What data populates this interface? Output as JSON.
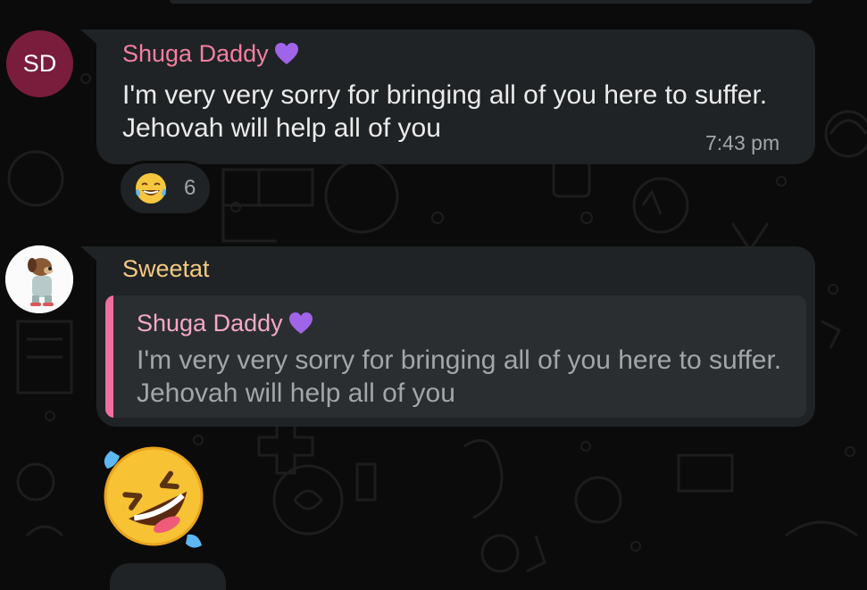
{
  "messages": [
    {
      "avatar_initials": "SD",
      "sender": "Shuga Daddy",
      "sender_badge": "purple-heart-icon",
      "text": "I'm very very sorry for bringing all of you here to suffer. Jehovah will help all of you",
      "time": "7:43 pm",
      "reaction": {
        "emoji": "face-with-tears-of-joy",
        "count": "6"
      }
    },
    {
      "sender": "Sweetat",
      "reply_to": {
        "sender": "Shuga Daddy",
        "sender_badge": "purple-heart-icon",
        "text": "I'm very very sorry for bringing all of you here to suffer. Jehovah will help all of you"
      },
      "content_emoji": "rolling-on-the-floor-laughing"
    }
  ],
  "colors": {
    "background": "#0b0b0b",
    "bubble": "#1f2325",
    "sender1": "#f47fa1",
    "sender2": "#f4c982",
    "quote_bar": "#f06fa0"
  }
}
